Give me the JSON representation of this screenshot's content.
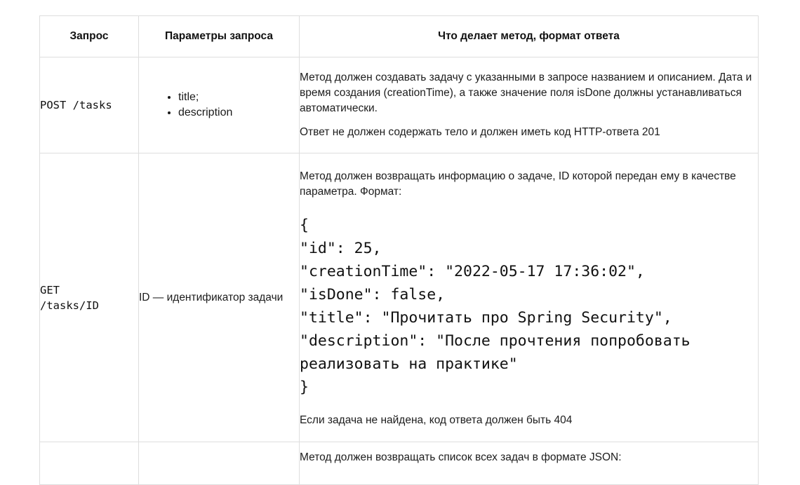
{
  "table": {
    "headers": {
      "request": "Запрос",
      "params": "Параметры запроса",
      "description": "Что делает метод, формат ответа"
    },
    "rows": [
      {
        "request": "POST /tasks",
        "params": [
          "title;",
          "description"
        ],
        "desc_p1": "Метод должен создавать задачу с указанными в запросе названием и описанием. Дата и время создания (creationTime), а также значение поля isDone должны устанавливаться автоматически.",
        "desc_p2": "Ответ не должен содержать тело и должен иметь код HTTP-ответа 201"
      },
      {
        "request_line1": "GET",
        "request_line2": "/tasks/ID",
        "params": "ID — идентификатор задачи",
        "desc_p1": "Метод должен возвращать информацию о задаче, ID которой передан ему в качестве параметра. Формат:",
        "json": "{\n\"id\": 25,\n\"creationTime\": \"2022-05-17 17:36:02\",\n\"isDone\": false,\n\"title\": \"Прочитать про Spring Security\",\n\"description\": \"После прочтения попробовать реализовать на практике\"\n}",
        "desc_p2": "Если задача не найдена, код ответа должен быть 404"
      },
      {
        "desc_p1": "Метод должен возвращать список всех задач в формате JSON:"
      }
    ]
  }
}
